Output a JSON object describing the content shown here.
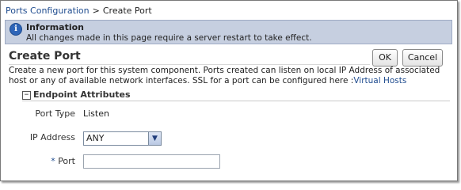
{
  "breadcrumb": {
    "parent": "Ports Configuration",
    "separator": ">",
    "current": "Create Port"
  },
  "info": {
    "icon": "info-icon",
    "title": "Information",
    "message": "All changes made in this page require a server restart to take effect."
  },
  "page": {
    "title": "Create Port",
    "ok_label": "OK",
    "cancel_label": "Cancel",
    "description": "Create a new port for this system component. Ports created can listen on local IP Address of associated host or any of available network interfaces. SSL for a port can be configured here :",
    "description_link": "Virtual Hosts"
  },
  "section": {
    "toggle": "−",
    "title": "Endpoint Attributes"
  },
  "form": {
    "port_type_label": "Port Type",
    "port_type_value": "Listen",
    "ip_label": "IP Address",
    "ip_selected": "ANY",
    "port_required_marker": "*",
    "port_label": "Port",
    "port_value": ""
  },
  "colors": {
    "link": "#1f4c8f",
    "info_bar": "#c6cfe0"
  }
}
